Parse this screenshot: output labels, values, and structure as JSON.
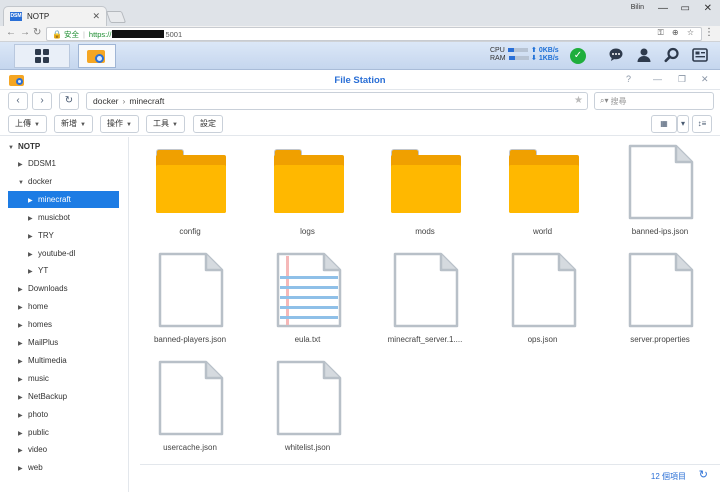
{
  "browser": {
    "tab_title": "NOTP",
    "tab_favicon": "DSM",
    "user": "Bilin",
    "address": {
      "secure_label": "安全",
      "scheme": "https://",
      "port_suffix": "5001"
    }
  },
  "taskbar": {
    "cpu_label": "CPU",
    "ram_label": "RAM",
    "upload": "0KB/s",
    "download": "1KB/s",
    "icons": [
      "chat-icon",
      "user-icon",
      "search-icon",
      "widgets-icon"
    ]
  },
  "window": {
    "title": "File Station",
    "path": [
      "docker",
      "minecraft"
    ],
    "search_placeholder": "搜尋"
  },
  "toolbar": {
    "upload": "上傳",
    "create": "新增",
    "action": "操作",
    "tools": "工具",
    "settings": "設定"
  },
  "tree": {
    "root": "NOTP",
    "items": [
      {
        "label": "DDSM1",
        "level": 1,
        "expanded": false
      },
      {
        "label": "docker",
        "level": 1,
        "expanded": true
      },
      {
        "label": "minecraft",
        "level": 2,
        "expanded": false,
        "selected": true
      },
      {
        "label": "musicbot",
        "level": 2,
        "expanded": false
      },
      {
        "label": "TRY",
        "level": 2,
        "expanded": false
      },
      {
        "label": "youtube-dl",
        "level": 2,
        "expanded": false
      },
      {
        "label": "YT",
        "level": 2,
        "expanded": false
      },
      {
        "label": "Downloads",
        "level": 1,
        "expanded": false
      },
      {
        "label": "home",
        "level": 1,
        "expanded": false
      },
      {
        "label": "homes",
        "level": 1,
        "expanded": false
      },
      {
        "label": "MailPlus",
        "level": 1,
        "expanded": false
      },
      {
        "label": "Multimedia",
        "level": 1,
        "expanded": false
      },
      {
        "label": "music",
        "level": 1,
        "expanded": false
      },
      {
        "label": "NetBackup",
        "level": 1,
        "expanded": false
      },
      {
        "label": "photo",
        "level": 1,
        "expanded": false
      },
      {
        "label": "public",
        "level": 1,
        "expanded": false
      },
      {
        "label": "video",
        "level": 1,
        "expanded": false
      },
      {
        "label": "web",
        "level": 1,
        "expanded": false
      }
    ]
  },
  "files": [
    {
      "name": "config",
      "type": "folder"
    },
    {
      "name": "logs",
      "type": "folder"
    },
    {
      "name": "mods",
      "type": "folder"
    },
    {
      "name": "world",
      "type": "folder"
    },
    {
      "name": "banned-ips.json",
      "type": "file"
    },
    {
      "name": "banned-players.json",
      "type": "file"
    },
    {
      "name": "eula.txt",
      "type": "text"
    },
    {
      "name": "minecraft_server.1....",
      "type": "file"
    },
    {
      "name": "ops.json",
      "type": "file"
    },
    {
      "name": "server.properties",
      "type": "file"
    },
    {
      "name": "usercache.json",
      "type": "file"
    },
    {
      "name": "whitelist.json",
      "type": "file"
    }
  ],
  "status": {
    "count": "12 個項目"
  },
  "colors": {
    "accent": "#1d7ce4",
    "folder": "#ffb800",
    "ok": "#1fae3c"
  }
}
